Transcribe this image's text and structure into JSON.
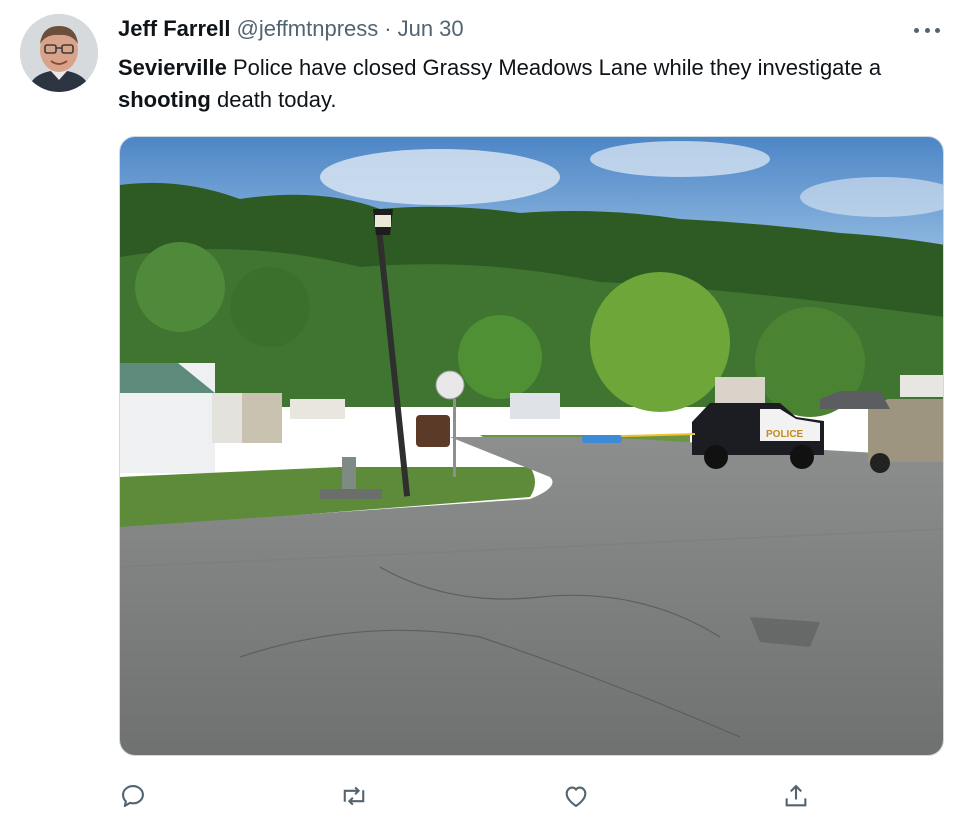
{
  "tweet": {
    "author": {
      "display_name": "Jeff Farrell",
      "handle": "@jeffmtnpress"
    },
    "separator": "·",
    "date": "Jun 30",
    "text": {
      "part1_bold": "Sevierville",
      "part2": " Police have closed Grassy Meadows Lane while they investigate a ",
      "part3_bold": "shooting",
      "part4": " death today."
    },
    "media": {
      "vehicle_label": "POLICE"
    }
  },
  "icons": {
    "more": "more-horizontal-icon",
    "reply": "reply-bubble-icon",
    "retweet": "retweet-icon",
    "like": "heart-icon",
    "share": "share-upload-icon"
  },
  "colors": {
    "text_primary": "#0f1419",
    "text_secondary": "#536471",
    "icon": "#536471",
    "border": "#cfd9de"
  }
}
